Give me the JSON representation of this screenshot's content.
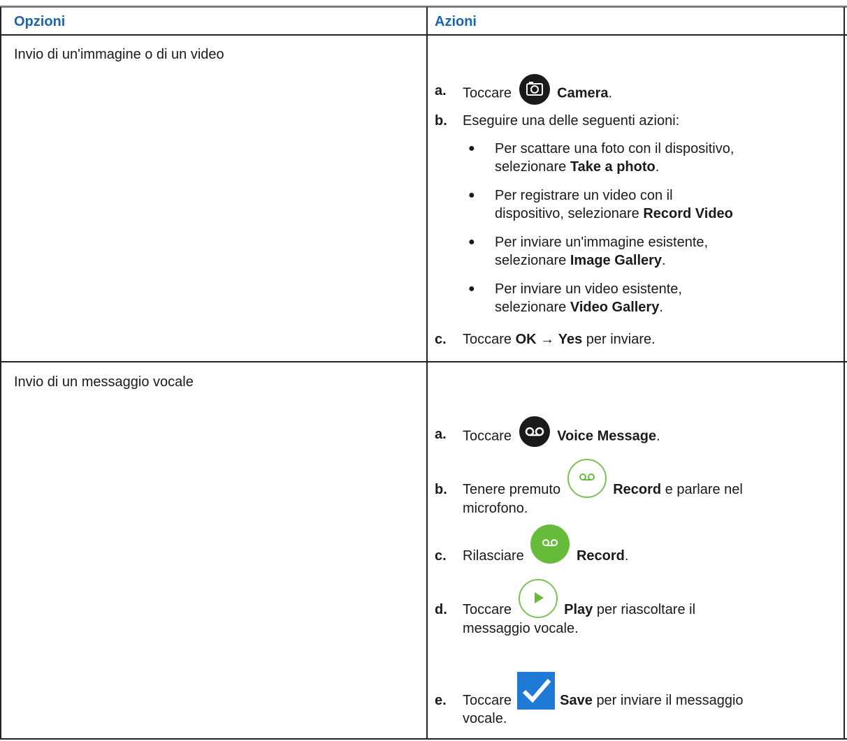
{
  "headers": {
    "options": "Opzioni",
    "actions": "Azioni"
  },
  "rows": [
    {
      "option": "Invio di un'immagine o di un video",
      "steps": {
        "a": {
          "letter": "a.",
          "pre": "Toccare",
          "bold": "Camera",
          "post": "."
        },
        "b": {
          "letter": "b.",
          "text": "Eseguire una delle seguenti azioni:"
        },
        "bullets": [
          {
            "l1": "Per scattare una foto con il dispositivo,",
            "pre": "selezionare",
            "bold": "Take a photo",
            "post": "."
          },
          {
            "l1": "Per registrare un video con il",
            "pre": "dispositivo, selezionare",
            "bold": "Record Video",
            "post": ""
          },
          {
            "l1": "Per inviare un'immagine esistente,",
            "pre": "selezionare",
            "bold": "Image Gallery",
            "post": "."
          },
          {
            "l1": "Per inviare un video esistente,",
            "pre": "selezionare",
            "bold": "Video Gallery",
            "post": "."
          }
        ],
        "c": {
          "letter": "c.",
          "pre": "Toccare",
          "bold1": "OK",
          "arrow": "→",
          "bold2": "Yes",
          "post": "per inviare."
        }
      }
    },
    {
      "option": "Invio di un messaggio vocale",
      "steps": {
        "a": {
          "letter": "a.",
          "pre": "Toccare",
          "bold": "Voice Message",
          "post": "."
        },
        "b": {
          "letter": "b.",
          "pre": "Tenere premuto",
          "bold": "Record",
          "post": "e parlare nel",
          "l2": "microfono."
        },
        "c": {
          "letter": "c.",
          "pre": "Rilasciare",
          "bold": "Record",
          "post": "."
        },
        "d": {
          "letter": "d.",
          "pre": "Toccare",
          "bold": "Play",
          "post": "per riascoltare il",
          "l2": "messaggio vocale."
        },
        "e": {
          "letter": "e.",
          "pre": "Toccare",
          "bold": "Save",
          "post": "per inviare il messaggio",
          "l2": "vocale."
        }
      }
    }
  ],
  "icons": {
    "camera": "camera-icon",
    "voicemail": "voicemail-icon",
    "record_outline": "record-outline-icon",
    "record_filled": "record-filled-icon",
    "play": "play-icon",
    "save": "checkmark-icon"
  },
  "colors": {
    "header_text": "#1b64b0",
    "green": "#66bb3a",
    "check_blue": "#1f7ad6"
  }
}
